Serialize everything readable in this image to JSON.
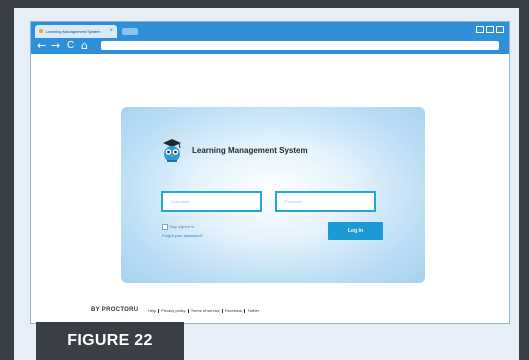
{
  "browser": {
    "tab_title": "Learning Management System",
    "tab_close": "×",
    "nav": {
      "back_icon": "←",
      "forward_icon": "→",
      "reload_icon": "C",
      "home_icon": "⌂"
    },
    "url": ""
  },
  "login": {
    "app_title": "Learning Management System",
    "username_placeholder": "Username",
    "password_placeholder": "Password",
    "stay_signed_in": "Stay signed in",
    "forgot_password": "Forgot your password?",
    "login_button": "Log In"
  },
  "footer": {
    "brand": "BY PROCTORU",
    "links": [
      "Help",
      "Privacy policy",
      "Terms of service",
      "Facebook",
      "Twitter"
    ]
  },
  "figure_label": "FIGURE 22",
  "colors": {
    "chrome_blue": "#2f8fd8",
    "field_border": "#25a6d8",
    "login_button": "#1d9ad6",
    "frame": "#3a3f45"
  }
}
